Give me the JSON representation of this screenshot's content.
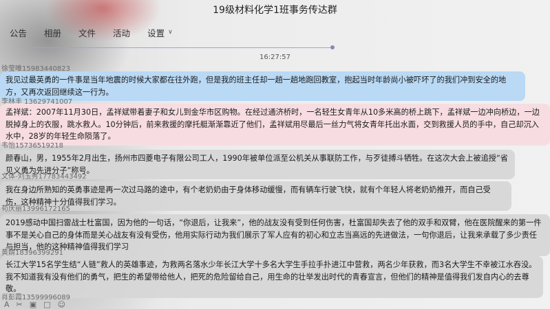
{
  "window": {
    "title": "19级材料化学1班事务传达群"
  },
  "nav": {
    "items": [
      "公告",
      "相册",
      "文件",
      "活动",
      "设置"
    ],
    "settings_chevron": "chevron-down-icon"
  },
  "chat": {
    "timestamp": "16:27:57",
    "messages": [
      {
        "sender": "徐莹唯15983440823",
        "text": "我见过最英勇的一件事是当年地震的时候大家都在往外跑，但是我的班主任却一趟一趟地跑回教室，抱起当时年龄尚小被吓坏了的我们冲到安全的地方，又再次返回继续这一行为。"
      },
      {
        "sender": "李林丰 13629741007",
        "text": "孟祥斌：2007年11月30日，孟祥斌带着妻子和女儿到金华市区购物。在经过通济桥时，一名轻生女青年从10多米高的桥上跳下，孟祥斌一边冲向桥边，一边脱掉身上的衣服，跳水救人。10分钟后，前来救援的摩托艇渐渐靠近了他们，孟祥斌用尽最后一丝力气将女青年托出水面，交到救援人员的手中，自己却沉入水中，28岁的年轻生命陨落了。"
      },
      {
        "sender": "韦怡15736519218",
        "text": "颜春山，男，1955年2月出生，扬州市四菱电子有限公司工人，1990年被单位派至公机关从事联防工作，与歹徒搏斗牺牲。在这次大会上被追授“省见义勇为先进分子”称号。"
      },
      {
        "sender": "文体-刘玉秀17783443492",
        "text": "我在身边所熟知的英勇事迹是再一次过马路的途中，有个老奶奶由于身体移动缓慢，而有辆车行驶飞快，就有个年轻人将老奶奶推开，而自己受伤，这种精神十分值得我们学习。"
      },
      {
        "sender": "苟庆丽13996172165",
        "text": "2019感动中国扫雷战士杜富国，因为他的一句话，“你退后，让我来”，他的战友没有受到任何伤害，杜富国却失去了他的双手和双臂，他在医院醒来的第一件事不是关心自己的身体而是关心战友有没有受伤，他用实际行动为我们展示了军人应有的初心和立志当高远的先进做法，一句你退后，让我来承载了多少责任与担当，他的这种精神值得我们学习"
      },
      {
        "sender": "黄婧18396399291",
        "text": "长江大学15名学生结“人链”救人的英雄事迹，为救两名落水少年长江大学十多名大学生手拉手扑进江中营救，两名少年获救，而3名大学生不幸被江水吞没。我不知道我有没有他们的勇气，把生的希望带给他人，把死的危险留给自己，用生命的壮举发出时代的青春宣言，但他们的精神是值得我们发自内心的去尊敬。"
      }
    ],
    "partial_sender": "肖彭霞13599996089"
  },
  "toolbar": {
    "icons": [
      "font-icon",
      "scissors-icon",
      "image-icon",
      "file-icon",
      "emoji-icon"
    ]
  },
  "colors": {
    "bubble_gray": "#d6d6d6",
    "bubble_blue": "#b9d9f5",
    "bubble_pink": "#f7dde2"
  }
}
